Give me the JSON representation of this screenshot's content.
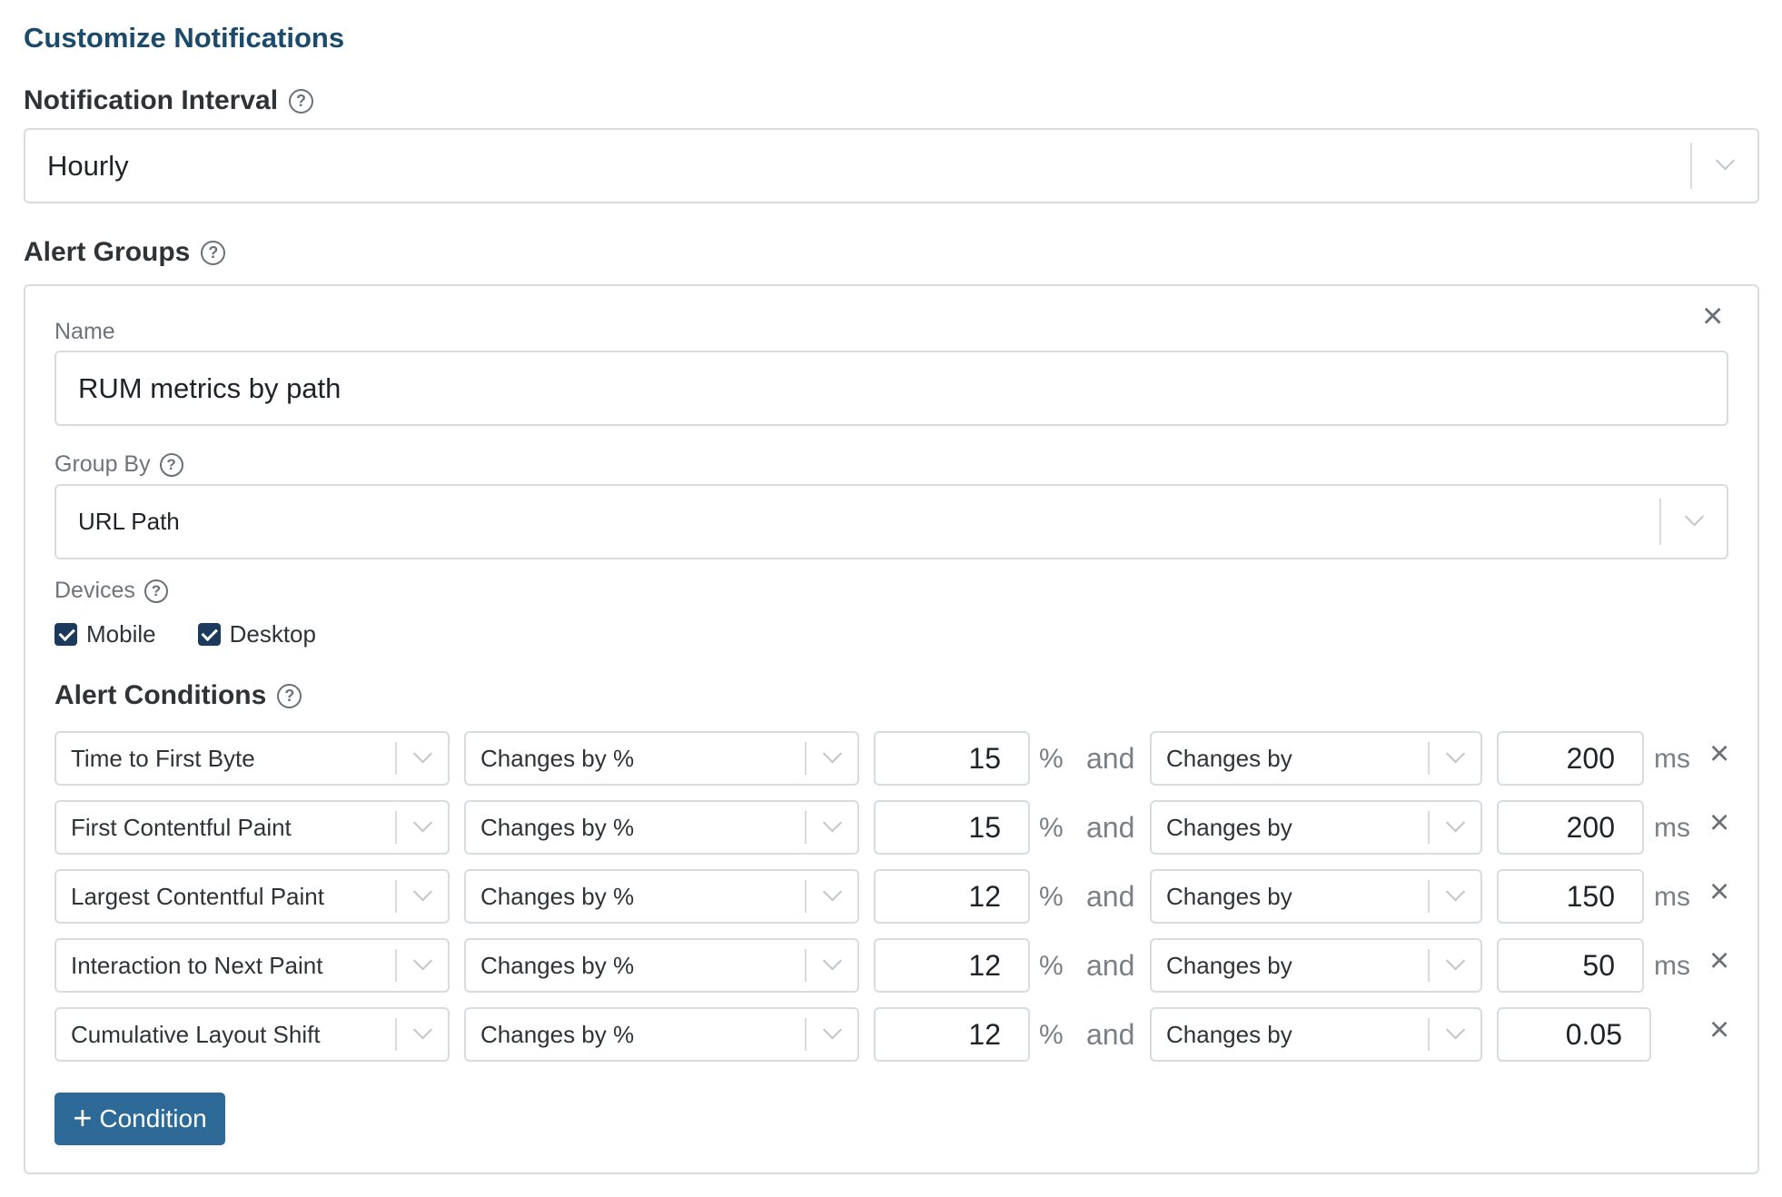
{
  "header": {
    "title": "Customize Notifications"
  },
  "notification_interval": {
    "label": "Notification Interval",
    "help_icon": "help-circle-icon",
    "value": "Hourly"
  },
  "alert_groups": {
    "label": "Alert Groups",
    "help_icon": "help-circle-icon",
    "group": {
      "close_icon": "close-icon",
      "name_label": "Name",
      "name_value": "RUM metrics by path",
      "group_by_label": "Group By",
      "group_by_value": "URL Path",
      "devices_label": "Devices",
      "devices": [
        {
          "label": "Mobile",
          "checked": true
        },
        {
          "label": "Desktop",
          "checked": true
        }
      ],
      "conditions_label": "Alert Conditions",
      "conditions": [
        {
          "metric": "Time to First Byte",
          "op1": "Changes by %",
          "val1": "15",
          "unit1": "%",
          "join": "and",
          "op2": "Changes by",
          "val2": "200",
          "unit2": "ms"
        },
        {
          "metric": "First Contentful Paint",
          "op1": "Changes by %",
          "val1": "15",
          "unit1": "%",
          "join": "and",
          "op2": "Changes by",
          "val2": "200",
          "unit2": "ms"
        },
        {
          "metric": "Largest Contentful Paint",
          "op1": "Changes by %",
          "val1": "12",
          "unit1": "%",
          "join": "and",
          "op2": "Changes by",
          "val2": "150",
          "unit2": "ms"
        },
        {
          "metric": "Interaction to Next Paint",
          "op1": "Changes by %",
          "val1": "12",
          "unit1": "%",
          "join": "and",
          "op2": "Changes by",
          "val2": "50",
          "unit2": "ms"
        },
        {
          "metric": "Cumulative Layout Shift",
          "op1": "Changes by %",
          "val1": "12",
          "unit1": "%",
          "join": "and",
          "op2": "Changes by",
          "val2": "0.05",
          "unit2": ""
        }
      ],
      "add_button": {
        "icon": "plus-icon",
        "label": "Condition"
      }
    }
  },
  "colors": {
    "title": "#1b4a6b",
    "checkbox": "#1b3a5c",
    "button": "#2d6a97"
  }
}
